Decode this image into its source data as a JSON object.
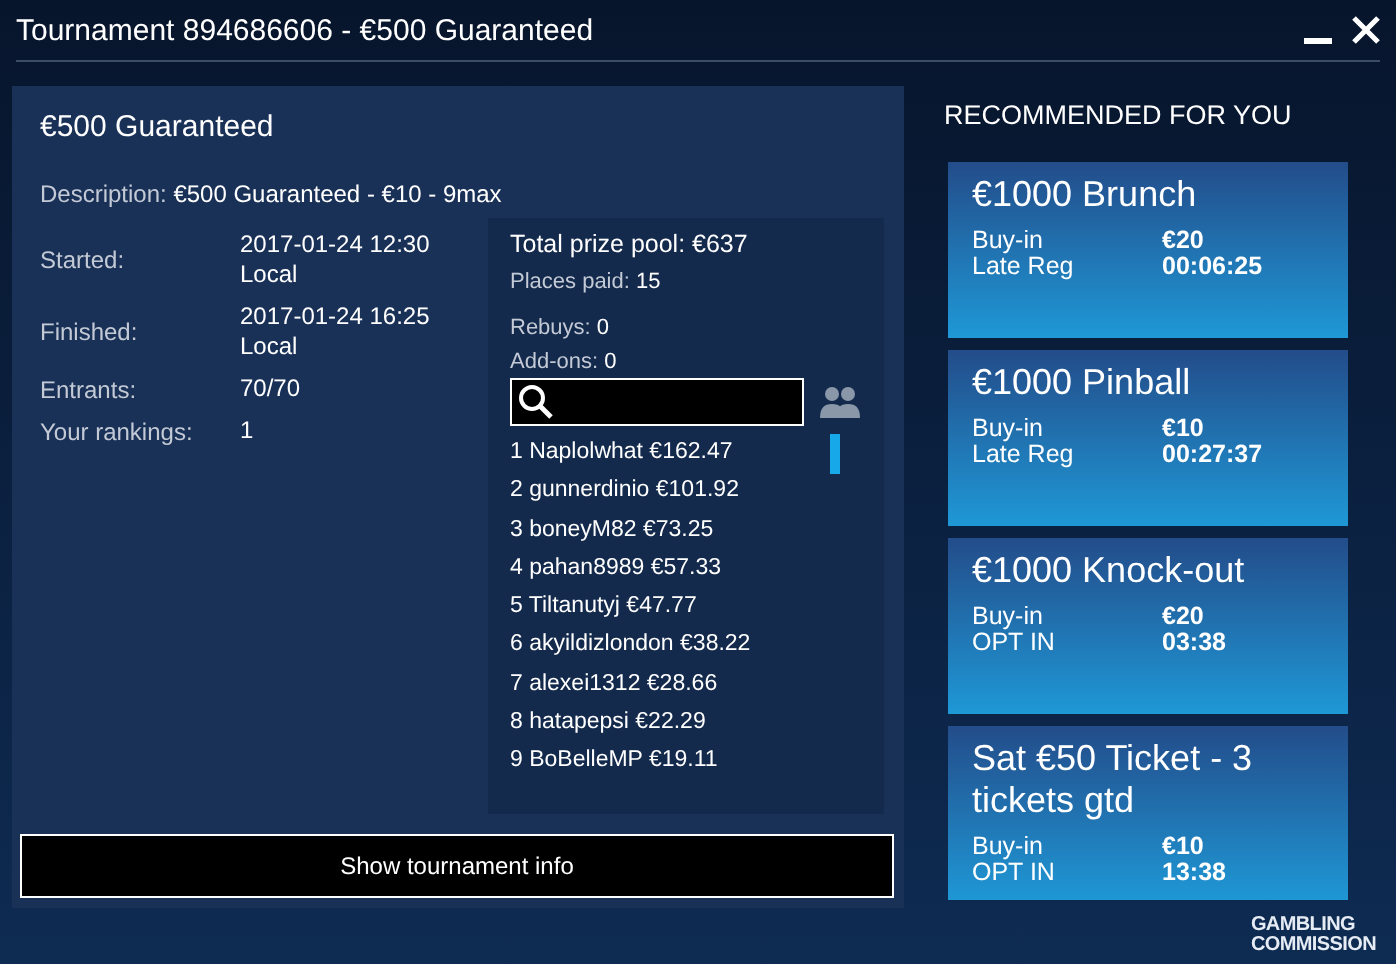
{
  "window": {
    "title": "Tournament 894686606 - €500 Guaranteed"
  },
  "tournament": {
    "name": "€500 Guaranteed",
    "description_label": "Description:",
    "description": "€500 Guaranteed - €10 - 9max",
    "details": [
      {
        "label": "Started:",
        "value": "2017-01-24 12:30 Local"
      },
      {
        "label": "Finished:",
        "value": "2017-01-24 16:25 Local"
      },
      {
        "label": "Entrants:",
        "value": "70/70"
      },
      {
        "label": "Your rankings:",
        "value": "1"
      }
    ],
    "prize_pool": "Total prize pool: €637",
    "places_paid_label": "Places paid:",
    "places_paid": "15",
    "rebuys_label": "Rebuys:",
    "rebuys": "0",
    "addons_label": "Add-ons:",
    "addons": "0",
    "rankings": [
      "1 Naplolwhat €162.47",
      "2 gunnerdinio €101.92",
      "3 boneyM82 €73.25",
      "4 pahan8989 €57.33",
      "5 Tiltanutyj €47.77",
      "6 akyildizlondon €38.22",
      "7 alexei1312 €28.66",
      "8 hatapepsi €22.29",
      "9 BoBelleMP €19.11"
    ],
    "button": "Show tournament info"
  },
  "recommended": {
    "heading": "RECOMMENDED FOR YOU",
    "cards": [
      {
        "title": "€1000 Brunch",
        "row1_label": "Buy-in",
        "row1_value": "€20",
        "row2_label": "Late Reg",
        "row2_value": "00:06:25"
      },
      {
        "title": "€1000 Pinball",
        "row1_label": "Buy-in",
        "row1_value": "€10",
        "row2_label": "Late Reg",
        "row2_value": "00:27:37"
      },
      {
        "title": "€1000 Knock-out",
        "row1_label": "Buy-in",
        "row1_value": "€20",
        "row2_label": "OPT IN",
        "row2_value": "03:38"
      },
      {
        "title": "Sat €50 Ticket - 3 tickets gtd",
        "row1_label": "Buy-in",
        "row1_value": "€10",
        "row2_label": "OPT IN",
        "row2_value": "13:38"
      }
    ]
  },
  "footer_logo": [
    "GAMBLING",
    "COMMISSION"
  ]
}
